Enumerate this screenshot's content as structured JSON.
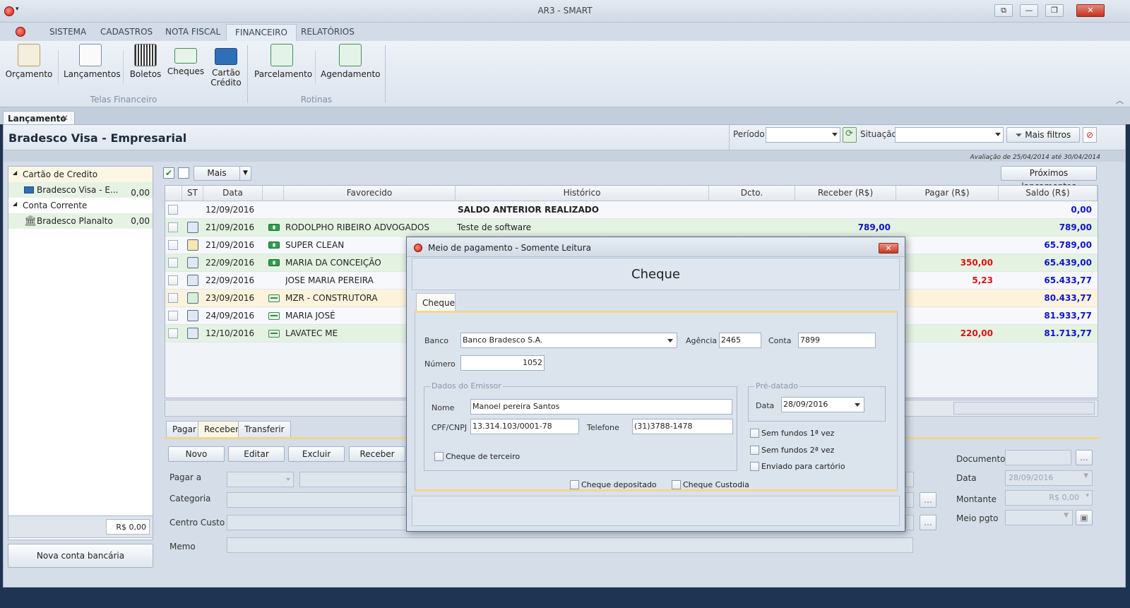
{
  "window": {
    "title": "AR3 - SMART"
  },
  "ribbon": {
    "tabs": [
      "SISTEMA",
      "CADASTROS",
      "NOTA FISCAL",
      "FINANCEIRO",
      "RELATÓRIOS"
    ],
    "buttons": [
      "Orçamento",
      "Lançamentos",
      "Boletos",
      "Cheques",
      "Cartão Crédito",
      "Parcelamento",
      "Agendamento"
    ],
    "groups": [
      "Telas Financeiro",
      "Rotinas"
    ]
  },
  "doc_tab": {
    "label": "Lançamento"
  },
  "header": {
    "title": "Bradesco Visa - Empresarial",
    "periodo_label": "Período",
    "situacao_label": "Situação",
    "mais_filtros": "Mais filtros",
    "avaliacao": "Avaliação de 25/04/2014 até 30/04/2014"
  },
  "tree": {
    "group1": "Cartão de Credito",
    "item1": {
      "name": "Bradesco Visa - E...",
      "value": "0,00"
    },
    "group2": "Conta Corrente",
    "item2": {
      "name": "Bradesco Planalto",
      "value": "0,00"
    },
    "total": "R$ 0,00",
    "nova_conta": "Nova conta bancária"
  },
  "grid_toolbar": {
    "mais": "Mais",
    "proximos": "Próximos lançamentos"
  },
  "grid": {
    "headers": [
      "ST",
      "Data",
      "Favorecido",
      "Histórico",
      "Dcto.",
      "Receber (R$)",
      "Pagar  (R$)",
      "Saldo (R$)"
    ],
    "rows": [
      {
        "data": "12/09/2016",
        "favorecido": "",
        "historico": "SALDO ANTERIOR REALIZADO",
        "receber": "",
        "pagar": "",
        "saldo": "0,00"
      },
      {
        "data": "21/09/2016",
        "favorecido": "RODOLPHO RIBEIRO ADVOGADOS",
        "historico": "Teste de software",
        "receber": "789,00",
        "pagar": "",
        "saldo": "789,00"
      },
      {
        "data": "21/09/2016",
        "favorecido": "SUPER CLEAN",
        "historico": "",
        "receber": "",
        "pagar": "",
        "saldo": "65.789,00"
      },
      {
        "data": "22/09/2016",
        "favorecido": "MARIA DA CONCEIÇÃO",
        "historico": "",
        "receber": "",
        "pagar": "350,00",
        "saldo": "65.439,00"
      },
      {
        "data": "22/09/2016",
        "favorecido": "JOSE MARIA PEREIRA",
        "historico": "",
        "receber": "",
        "pagar": "5,23",
        "saldo": "65.433,77"
      },
      {
        "data": "23/09/2016",
        "favorecido": "MZR - CONSTRUTORA",
        "historico": "",
        "receber": "",
        "pagar": "",
        "saldo": "80.433,77"
      },
      {
        "data": "24/09/2016",
        "favorecido": "MARIA JOSÉ",
        "historico": "",
        "receber": "",
        "pagar": "",
        "saldo": "81.933,77"
      },
      {
        "data": "12/10/2016",
        "favorecido": "LAVATEC ME",
        "historico": "",
        "receber": "",
        "pagar": "220,00",
        "saldo": "81.713,77"
      }
    ]
  },
  "bottom": {
    "tabs": [
      "Pagar",
      "Receber",
      "Transferir"
    ],
    "buttons": [
      "Novo",
      "Editar",
      "Excluir",
      "Receber"
    ],
    "labels": {
      "pagar_a": "Pagar a",
      "categoria": "Categoria",
      "centro_custo": "Centro Custo",
      "memo": "Memo",
      "documento": "Documento",
      "data": "Data",
      "montante": "Montante",
      "meio_pgto": "Meio pgto"
    },
    "data_value": "28/09/2016",
    "montante_value": "R$ 0,00",
    "dots": "..."
  },
  "modal": {
    "title": "Meio de pagamento - Somente Leitura",
    "header": "Cheque",
    "tab": "Cheque",
    "banco_label": "Banco",
    "banco_value": "Banco Bradesco S.A.",
    "agencia_label": "Agência",
    "agencia_value": "2465",
    "conta_label": "Conta",
    "conta_value": "7899",
    "numero_label": "Número",
    "numero_value": "1052",
    "emissor_legend": "Dados do Emissor",
    "nome_label": "Nome",
    "nome_value": "Manoel pereira Santos",
    "cpf_label": "CPF/CNPJ",
    "cpf_value": "13.314.103/0001-78",
    "telefone_label": "Telefone",
    "telefone_value": "(31)3788-1478",
    "cheque_terceiro": "Cheque de terceiro",
    "predatado_legend": "Pré-datado",
    "data_label": "Data",
    "data_value": "28/09/2016",
    "sem_fundos_1": "Sem fundos 1ª vez",
    "sem_fundos_2": "Sem fundos 2ª vez",
    "enviado_cartorio": "Enviado para cartório",
    "cheque_depositado": "Cheque depositado",
    "cheque_custodia": "Cheque Custodia"
  },
  "colors": {
    "accent_yellow": "#f0d58c",
    "positive_blue": "#0f14c8",
    "negative_red": "#e01010",
    "row_green": "#e4f2e2",
    "row_yellow": "#fdf3dc"
  }
}
